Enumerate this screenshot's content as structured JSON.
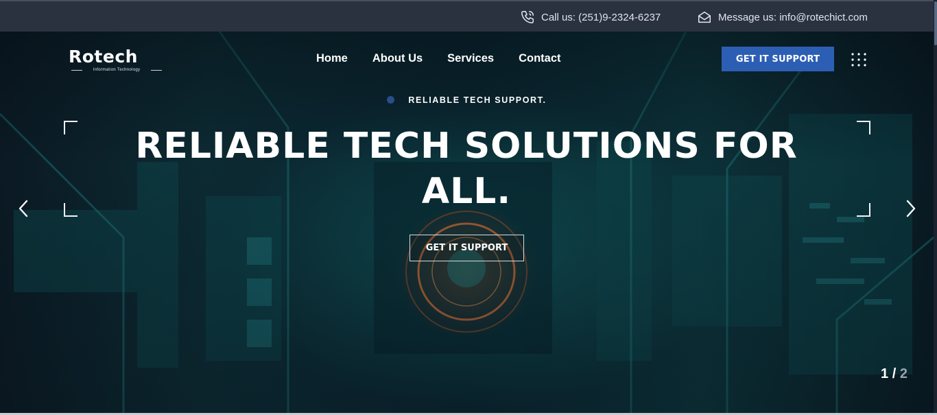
{
  "topbar": {
    "phone_icon": "phone-icon",
    "phone_text": "Call us: (251)9-2324-6237",
    "mail_icon": "envelope-icon",
    "mail_text": "Message us: info@rotechict.com"
  },
  "header": {
    "logo_word": "Rotech",
    "logo_tagline": "Information Technology",
    "nav": [
      "Home",
      "About Us",
      "Services",
      "Contact"
    ],
    "cta_label": "GET IT SUPPORT",
    "menu_icon": "grid-dots-icon"
  },
  "hero": {
    "eyebrow": "RELIABLE TECH SUPPORT.",
    "headline_line1": "RELIABLE TECH SOLUTIONS FOR",
    "headline_line2": "ALL.",
    "cta_label": "GET IT SUPPORT",
    "slide_current": "1",
    "slide_separator": "/",
    "slide_total": "2",
    "prev_icon": "chevron-left-icon",
    "next_icon": "chevron-right-icon"
  },
  "colors": {
    "topbar_bg": "#2a3240",
    "cta_bg": "#2c5fb4",
    "accent_dot": "#2a4d8c"
  }
}
